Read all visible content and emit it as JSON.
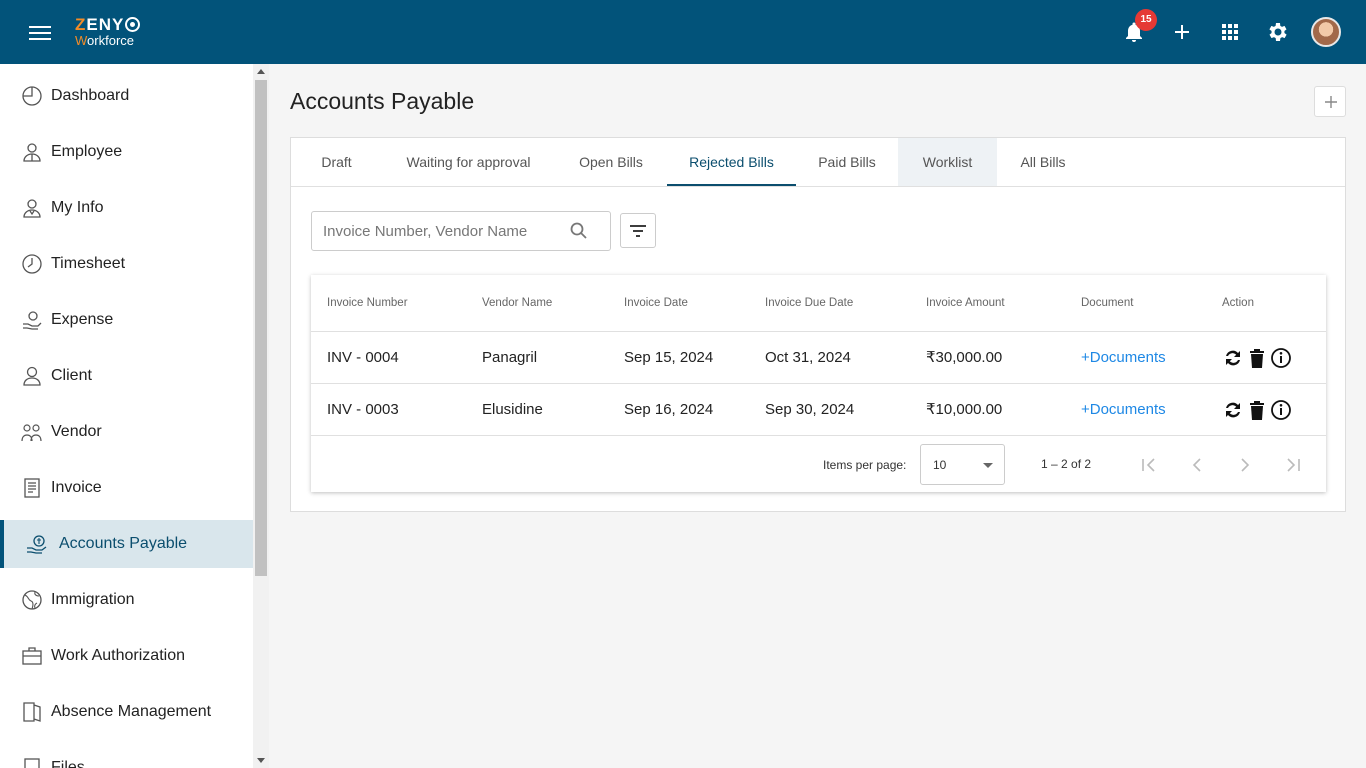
{
  "app": {
    "logo_top": "ZENY",
    "logo_bottom": "Workforce",
    "notification_count": "15"
  },
  "sidebar": {
    "items": [
      {
        "label": "Dashboard",
        "icon": "dashboard-icon"
      },
      {
        "label": "Employee",
        "icon": "employee-icon"
      },
      {
        "label": "My Info",
        "icon": "my-info-icon"
      },
      {
        "label": "Timesheet",
        "icon": "clock-icon"
      },
      {
        "label": "Expense",
        "icon": "expense-icon"
      },
      {
        "label": "Client",
        "icon": "client-icon"
      },
      {
        "label": "Vendor",
        "icon": "vendor-icon"
      },
      {
        "label": "Invoice",
        "icon": "invoice-icon"
      },
      {
        "label": "Accounts Payable",
        "icon": "accounts-payable-icon",
        "active": true
      },
      {
        "label": "Immigration",
        "icon": "globe-icon"
      },
      {
        "label": "Work Authorization",
        "icon": "briefcase-icon"
      },
      {
        "label": "Absence Management",
        "icon": "door-icon"
      },
      {
        "label": "Files",
        "icon": "files-icon"
      }
    ]
  },
  "main": {
    "title": "Accounts Payable",
    "tabs": [
      {
        "label": "Draft"
      },
      {
        "label": "Waiting for approval"
      },
      {
        "label": "Open Bills"
      },
      {
        "label": "Rejected Bills",
        "active": true
      },
      {
        "label": "Paid Bills"
      },
      {
        "label": "Worklist"
      },
      {
        "label": "All Bills"
      }
    ],
    "search": {
      "placeholder": "Invoice Number, Vendor Name",
      "value": ""
    },
    "table": {
      "columns": [
        "Invoice Number",
        "Vendor Name",
        "Invoice Date",
        "Invoice Due Date",
        "Invoice Amount",
        "Document",
        "Action"
      ],
      "rows": [
        {
          "invoice_number": "INV - 0004",
          "vendor": "Panagril",
          "invoice_date": "Sep 15, 2024",
          "due_date": "Oct 31, 2024",
          "amount": "₹30,000.00",
          "document": "+Documents"
        },
        {
          "invoice_number": "INV - 0003",
          "vendor": "Elusidine",
          "invoice_date": "Sep 16, 2024",
          "due_date": "Sep 30, 2024",
          "amount": "₹10,000.00",
          "document": "+Documents"
        }
      ]
    },
    "paginator": {
      "items_per_page_label": "Items per page:",
      "items_per_page": "10",
      "range": "1 – 2 of 2"
    }
  },
  "colors": {
    "header_bg": "#02537a",
    "active_bg": "#d9e6ec",
    "link": "#1e88e5",
    "badge": "#e53935",
    "logo_accent": "#f28c28"
  }
}
